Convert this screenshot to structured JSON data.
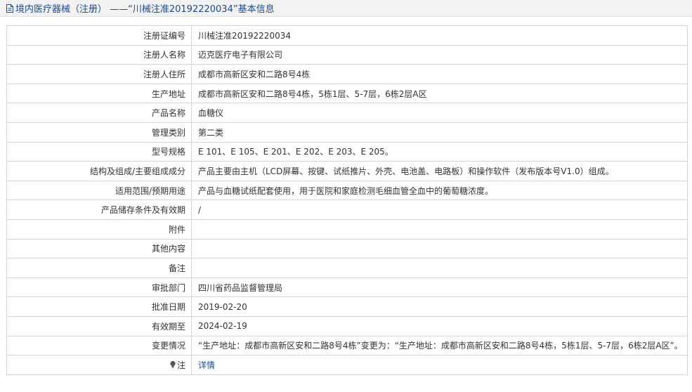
{
  "header": {
    "title": "境内医疗器械（注册） ——“川械注准20192220034”基本信息"
  },
  "rows": [
    {
      "label": "注册证编号",
      "value": "川械注准20192220034"
    },
    {
      "label": "注册人名称",
      "value": "迈克医疗电子有限公司"
    },
    {
      "label": "注册人住所",
      "value": "成都市高新区安和二路8号4栋"
    },
    {
      "label": "生产地址",
      "value": "成都市高新区安和二路8号4栋，5栋1层、5-7层，6栋2层A区"
    },
    {
      "label": "产品名称",
      "value": "血糖仪"
    },
    {
      "label": "管理类别",
      "value": "第二类"
    },
    {
      "label": "型号规格",
      "value": "E 101、E 105、E 201、E 202、E 203、E 205。"
    },
    {
      "label": "结构及组成/主要组成成分",
      "value": "产品主要由主机（LCD屏幕、按键、试纸推片、外壳、电池盖、电路板）和操作软件（发布版本号V1.0）组成。"
    },
    {
      "label": "适用范围/预期用途",
      "value": "产品与血糖试纸配套使用，用于医院和家庭检测毛细血管全血中的葡萄糖浓度。"
    },
    {
      "label": "产品储存条件及有效期",
      "value": "/"
    },
    {
      "label": "附件",
      "value": ""
    },
    {
      "label": "其他内容",
      "value": ""
    },
    {
      "label": "备注",
      "value": ""
    },
    {
      "label": "审批部门",
      "value": "四川省药品监督管理局"
    },
    {
      "label": "批准日期",
      "value": "2019-02-20"
    },
    {
      "label": "有效期至",
      "value": "2024-02-19"
    },
    {
      "label": "变更情况",
      "value": "“生产地址：成都市高新区安和二路8号4栋”变更为：“生产地址：成都市高新区安和二路8号4栋，5栋1层、5-7层，6栋2层A区”。"
    }
  ],
  "note_row": {
    "label": "注",
    "link": "详情",
    "icon": "lightbulb-icon"
  },
  "colors": {
    "header_bg": "#f2f2f2",
    "title_color": "#1a4a96",
    "border": "#d6d6d6",
    "link": "#1a4a96"
  }
}
